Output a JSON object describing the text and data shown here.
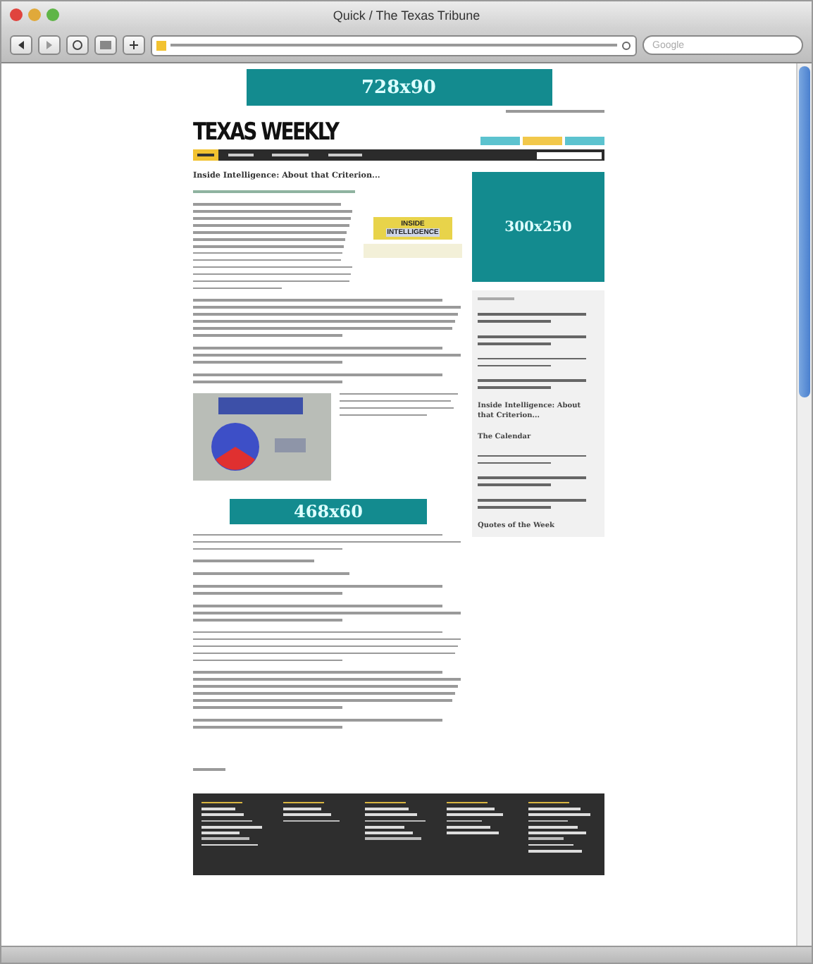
{
  "window": {
    "title": "Quick / The Texas Tribune"
  },
  "toolbar": {
    "search": {
      "placeholder": "Google"
    }
  },
  "top_ad": {
    "label": "728x90"
  },
  "masthead": {
    "logo": "TEXAS WEEKLY",
    "tabs": [
      {
        "color": "#5cc3cf"
      },
      {
        "color": "#f2c84b"
      },
      {
        "color": "#5cc3cf"
      }
    ]
  },
  "nav": {
    "items": [
      {
        "selected": true
      },
      {
        "selected": false
      },
      {
        "selected": false
      },
      {
        "selected": false
      }
    ]
  },
  "article": {
    "headline": "Inside Intelligence: About that Criterion...",
    "logo_lines": [
      "INSIDE",
      "INTELLIGENCE"
    ]
  },
  "side_ad": {
    "label": "300x250"
  },
  "sidebar": {
    "items": [
      {
        "kind": "greeked"
      },
      {
        "kind": "greeked"
      },
      {
        "kind": "greeked"
      },
      {
        "kind": "greeked"
      },
      {
        "kind": "text",
        "title": "Inside Intelligence: About that Criterion..."
      },
      {
        "kind": "text",
        "title": "The Calendar"
      },
      {
        "kind": "greeked"
      },
      {
        "kind": "greeked"
      },
      {
        "kind": "greeked"
      },
      {
        "kind": "text",
        "title": "Quotes of the Week"
      }
    ]
  },
  "inline_ad": {
    "label": "468x60"
  }
}
